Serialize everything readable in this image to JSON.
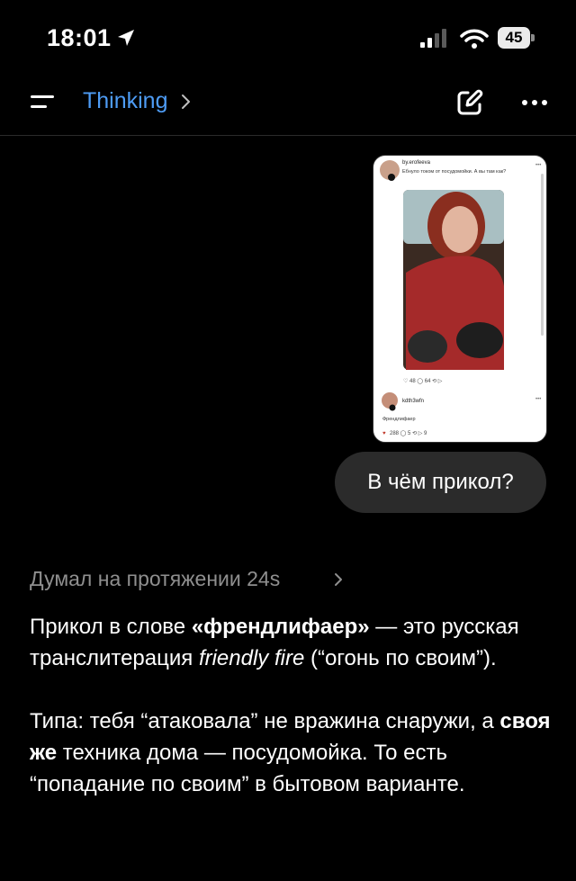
{
  "status_bar": {
    "time": "18:01",
    "battery": "45"
  },
  "nav": {
    "model_name": "Thinking"
  },
  "attachment": {
    "username": "by.erofeeva",
    "caption": "Ебнуло током от посудомойки. А вы там как?",
    "comment_username": "kdth3wfn",
    "comment_text": "Френдлифаер"
  },
  "user_message": {
    "text": "В чём прикол?"
  },
  "assistant": {
    "thought_label": "Думал на протяжении 24s",
    "p1": {
      "t1": "Прикол в слове ",
      "b1": "«френдлифаер»",
      "t2": " — это русская транслитерация ",
      "i1": "friendly fire",
      "t3": " (“огонь по своим”)."
    },
    "p2": {
      "t1": "Типа: тебя “атаковала” не вражина снаружи, а ",
      "b1": "своя же",
      "t2": " техника дома — посудомойка. То есть “попадание по своим” в бытовом варианте."
    }
  },
  "colors": {
    "background": "#000000",
    "accent": "#4e9cf5",
    "bubble": "#2b2b2b",
    "muted_text": "#8f8f8f"
  }
}
